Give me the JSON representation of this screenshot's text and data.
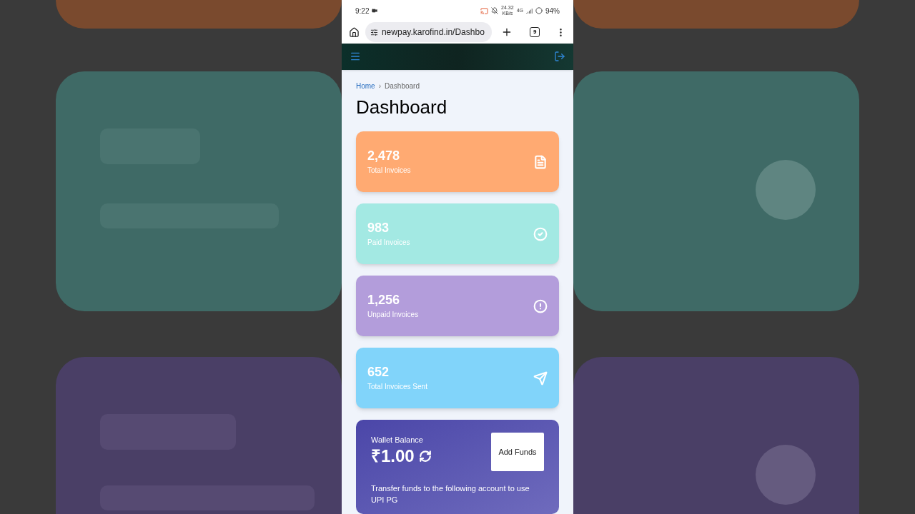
{
  "status_bar": {
    "time": "9:22",
    "speed_value": "24.32",
    "speed_unit": "KB/s",
    "network": "4G",
    "battery": "94%"
  },
  "browser": {
    "url": "newpay.karofind.in/Dashbo",
    "tab_count": "9"
  },
  "breadcrumb": [
    {
      "label": "Home",
      "kind": "link"
    },
    {
      "label": "›",
      "kind": "separator"
    },
    {
      "label": "Dashboard",
      "kind": "current"
    }
  ],
  "title": "Dashboard",
  "stats": [
    {
      "value": "2,478",
      "label": "Total Invoices",
      "kind": "document",
      "color": "#ffaa72"
    },
    {
      "value": "983",
      "label": "Paid Invoices",
      "kind": "check",
      "color": "#a3e9e3"
    },
    {
      "value": "1,256",
      "label": "Unpaid Invoices",
      "kind": "alert",
      "color": "#b39ddb"
    },
    {
      "value": "652",
      "label": "Total Invoices Sent",
      "kind": "send",
      "color": "#81d4fa"
    }
  ],
  "wallet": {
    "label": "Wallet Balance",
    "amount": "₹1.00",
    "button": "Add Funds",
    "note": "Transfer funds to the following account to use UPI PG"
  }
}
